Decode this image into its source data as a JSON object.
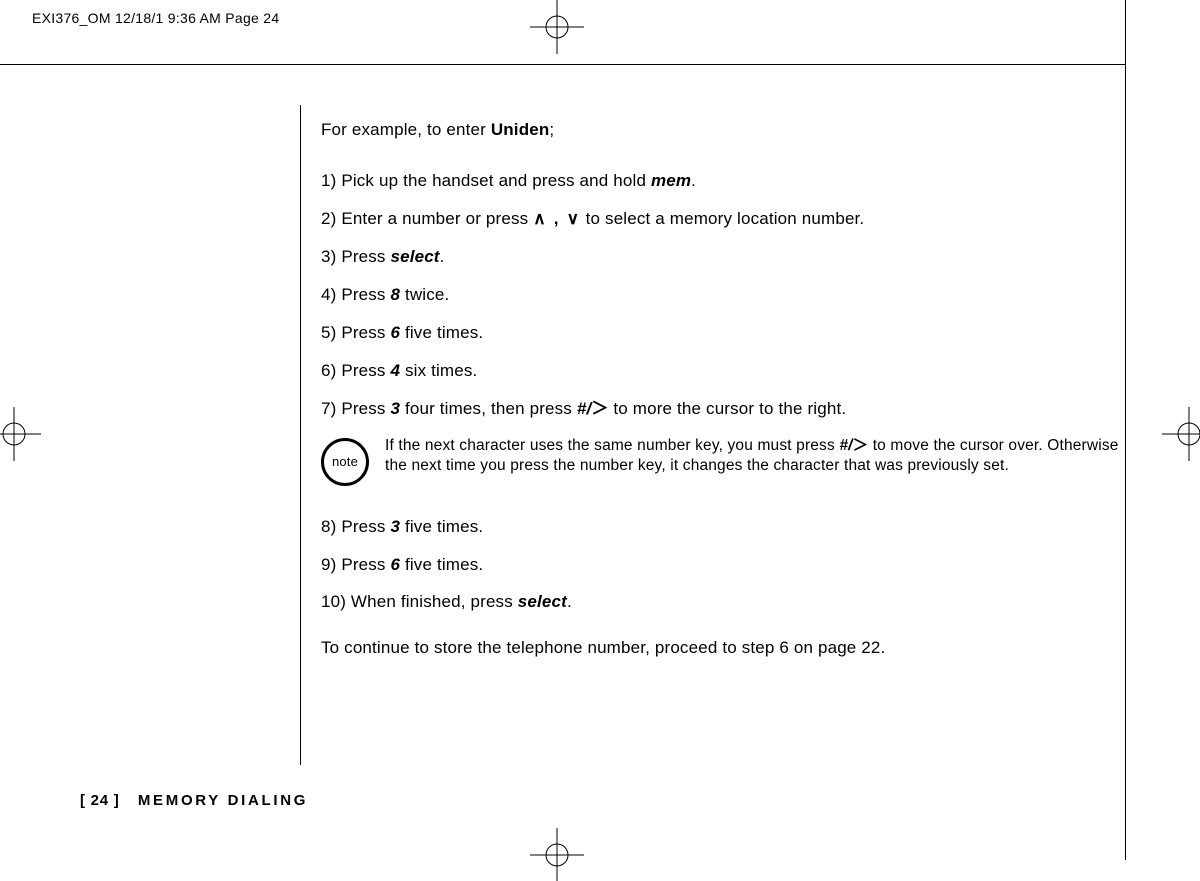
{
  "header": {
    "slug": "EXI376_OM  12/18/1 9:36 AM  Page 24"
  },
  "content": {
    "intro_prefix": "For example, to enter ",
    "intro_bold": "Uniden",
    "intro_suffix": ";",
    "step1_a": "1) Pick up the handset and press and hold ",
    "step1_b": "mem",
    "step1_c": ".",
    "step2_a": "2) Enter a number or press ",
    "step2_arrows": "∧ ,  ∨",
    "step2_b": " to select a memory location number.",
    "step3_a": "3) Press ",
    "step3_b": "select",
    "step3_c": ".",
    "step4_a": "4) Press ",
    "step4_b": "8",
    "step4_c": " twice.",
    "step5_a": "5) Press ",
    "step5_b": "6",
    "step5_c": " five times.",
    "step6_a": "6) Press ",
    "step6_b": "4",
    "step6_c": " six times.",
    "step7_a": "7) Press ",
    "step7_b": "3",
    "step7_c": " four times, then press ",
    "step7_d": "#/",
    "step7_e": " to more the cursor to the right.",
    "note_label": "note",
    "note_a": "If the next character uses the same number key, you must press ",
    "note_b": "#/",
    "note_c": " to move the cursor over. Otherwise the next time you press the number key, it changes the character that was previously set.",
    "step8_a": "8) Press ",
    "step8_b": "3",
    "step8_c": " five times.",
    "step9_a": "9) Press ",
    "step9_b": "6",
    "step9_c": " five times.",
    "step10_a": "10) When finished, press ",
    "step10_b": "select",
    "step10_c": ".",
    "outro": "To continue to store the telephone number, proceed to step 6 on page 22."
  },
  "footer": {
    "page": "[ 24 ]",
    "section": "MEMORY DIALING"
  }
}
